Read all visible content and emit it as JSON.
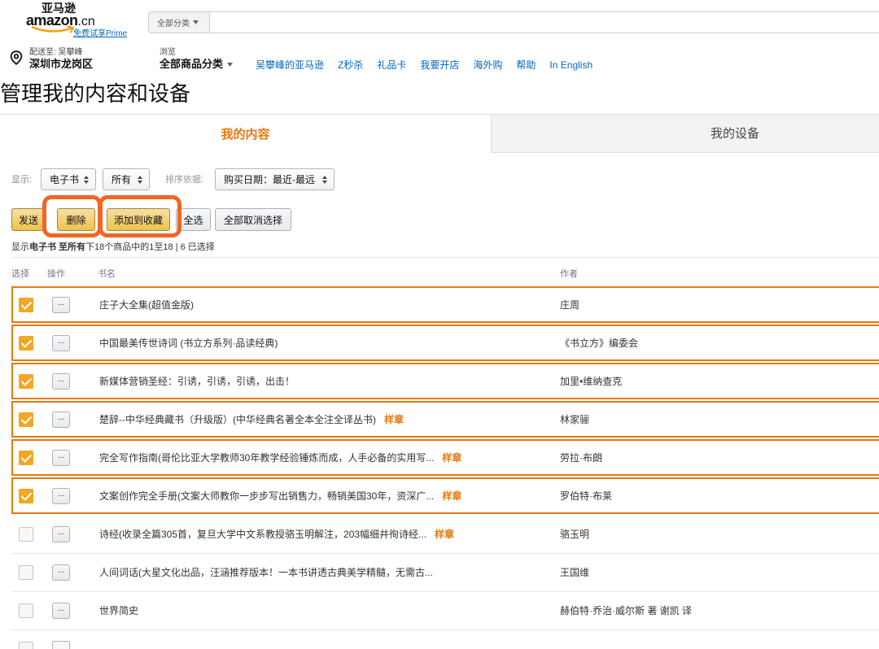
{
  "header": {
    "logo_cn": "亚马逊",
    "logo_text": "amazon",
    "logo_suffix": ".cn",
    "prime_link": "免费试享Prime",
    "search_category": "全部分类",
    "deliver_to_label": "配送至: 吴攀峰",
    "deliver_to_city": "深圳市龙岗区",
    "browse_label": "浏览",
    "browse_title": "全部商品分类",
    "nav_links": [
      "吴攀峰的亚马逊",
      "Z秒杀",
      "礼品卡",
      "我要开店",
      "海外购",
      "帮助",
      "In English"
    ]
  },
  "page_title": "管理我的内容和设备",
  "tabs": [
    {
      "label": "我的内容",
      "active": true
    },
    {
      "label": "我的设备",
      "active": false
    }
  ],
  "filters": {
    "show_label": "显示:",
    "content_type": "电子书",
    "scope": "所有",
    "sort_label": "排序依据:",
    "sort_value": "购买日期：最近-最远"
  },
  "actions": {
    "send": "发送",
    "delete": "删除",
    "add_to_collection": "添加到收藏",
    "select_all": "全选",
    "deselect_all": "全部取消选择"
  },
  "status": {
    "prefix": "显示",
    "bold": "电子书 至所有",
    "suffix": "下18个商品中的1至18 | 6 已选择"
  },
  "table": {
    "columns": {
      "select": "选择",
      "actions": "操作",
      "title": "书名",
      "author": "作者"
    },
    "ellipsis": "...",
    "sample_label": "样章",
    "rows": [
      {
        "selected": true,
        "title": "庄子大全集(超值金版)",
        "sample": false,
        "author": "庄周"
      },
      {
        "selected": true,
        "title": "中国最美传世诗词 (书立方系列·品读经典)",
        "sample": false,
        "author": "《书立方》编委会"
      },
      {
        "selected": true,
        "title": "新媒体营销圣经：引诱，引诱，引诱，出击！",
        "sample": false,
        "author": "加里•维纳查克"
      },
      {
        "selected": true,
        "title": "楚辞--中华经典藏书（升级版）(中华经典名著全本全注全译丛书)",
        "sample": true,
        "author": "林家骊"
      },
      {
        "selected": true,
        "title": "完全写作指南(哥伦比亚大学教师30年教学经验锤炼而成，人手必备的实用写...",
        "sample": true,
        "author": "劳拉·布朗"
      },
      {
        "selected": true,
        "title": "文案创作完全手册(文案大师教你一步步写出销售力，畅销美国30年，资深广...",
        "sample": true,
        "author": "罗伯特·布莱"
      },
      {
        "selected": false,
        "title": "诗经(收录全篇305首，复旦大学中文系教授骆玉明解注，203幅细井徇诗经...",
        "sample": true,
        "author": "骆玉明"
      },
      {
        "selected": false,
        "title": "人间词话(大星文化出品，汪涵推荐版本！一本书讲透古典美学精髓，无需古...",
        "sample": false,
        "author": "王国维"
      },
      {
        "selected": false,
        "title": "世界简史",
        "sample": false,
        "author": "赫伯特·乔治·威尔斯 著 谢凯 译"
      }
    ]
  },
  "icons": {
    "location": "location-pin-icon",
    "dropdown": "caret-down-icon",
    "select": "select-arrows-icon",
    "logo": "amazon-smile-icon"
  },
  "colors": {
    "accent": "#e47911",
    "link": "#0066c0",
    "checkbox_checked": "#f5a623",
    "annotation": "#f26522",
    "button_primary": "#f0c14b"
  }
}
